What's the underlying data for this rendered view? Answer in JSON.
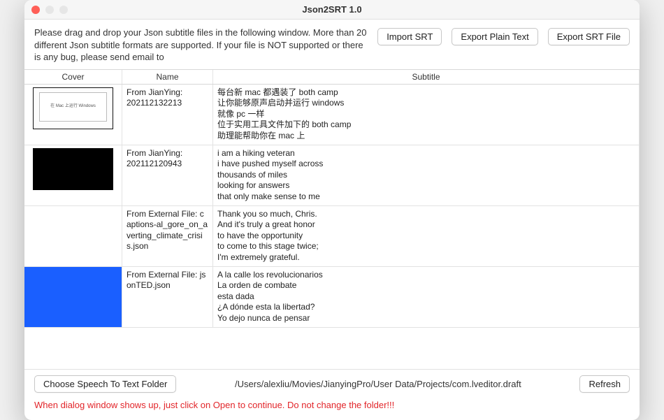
{
  "window": {
    "title": "Json2SRT 1.0"
  },
  "instructions": "Please drag and drop your Json subtitle files in the following window. More than 20 different Json subtitle formats are supported. If your file is NOT supported or there is any bug, please send email to",
  "toolbar": {
    "import": "Import SRT",
    "exportPlain": "Export Plain Text",
    "exportSrt": "Export SRT File"
  },
  "columns": {
    "cover": "Cover",
    "name": "Name",
    "subtitle": "Subtitle"
  },
  "rows": [
    {
      "coverType": "laptop",
      "coverText": "在 Mac 上运行 Windows",
      "name": "From JianYing: 202112132213",
      "subtitle": "每台新 mac 都遇装了 both camp\n让你能够原声启动并运行 windows\n就像 pc 一样\n位于实用工具文件加下的 both camp\n助理能帮助你在 mac 上"
    },
    {
      "coverType": "black",
      "name": "From JianYing: 202112120943",
      "subtitle": "i am a hiking veteran\ni have pushed myself across\nthousands of miles\nlooking for answers\nthat only make sense to me"
    },
    {
      "coverType": "none",
      "name": "From External File: captions-al_gore_on_averting_climate_crisis.json",
      "subtitle": "Thank you so much, Chris.\nAnd it's truly a great honor\nto have the opportunity\nto come to this stage twice;\nI'm extremely grateful."
    },
    {
      "coverType": "none",
      "name": "From External File: jsonTED.json",
      "subtitle": "A la calle los revolucionarios\nLa orden de combate\nesta dada\n¿A dónde esta la libertad?\nYo dejo nunca de pensar"
    }
  ],
  "footer": {
    "chooseFolder": "Choose Speech To Text Folder",
    "path": "/Users/alexliu/Movies/JianyingPro/User Data/Projects/com.lveditor.draft",
    "refresh": "Refresh",
    "warning": "When dialog window shows up, just click on Open to continue. Do not change the folder!!!"
  }
}
